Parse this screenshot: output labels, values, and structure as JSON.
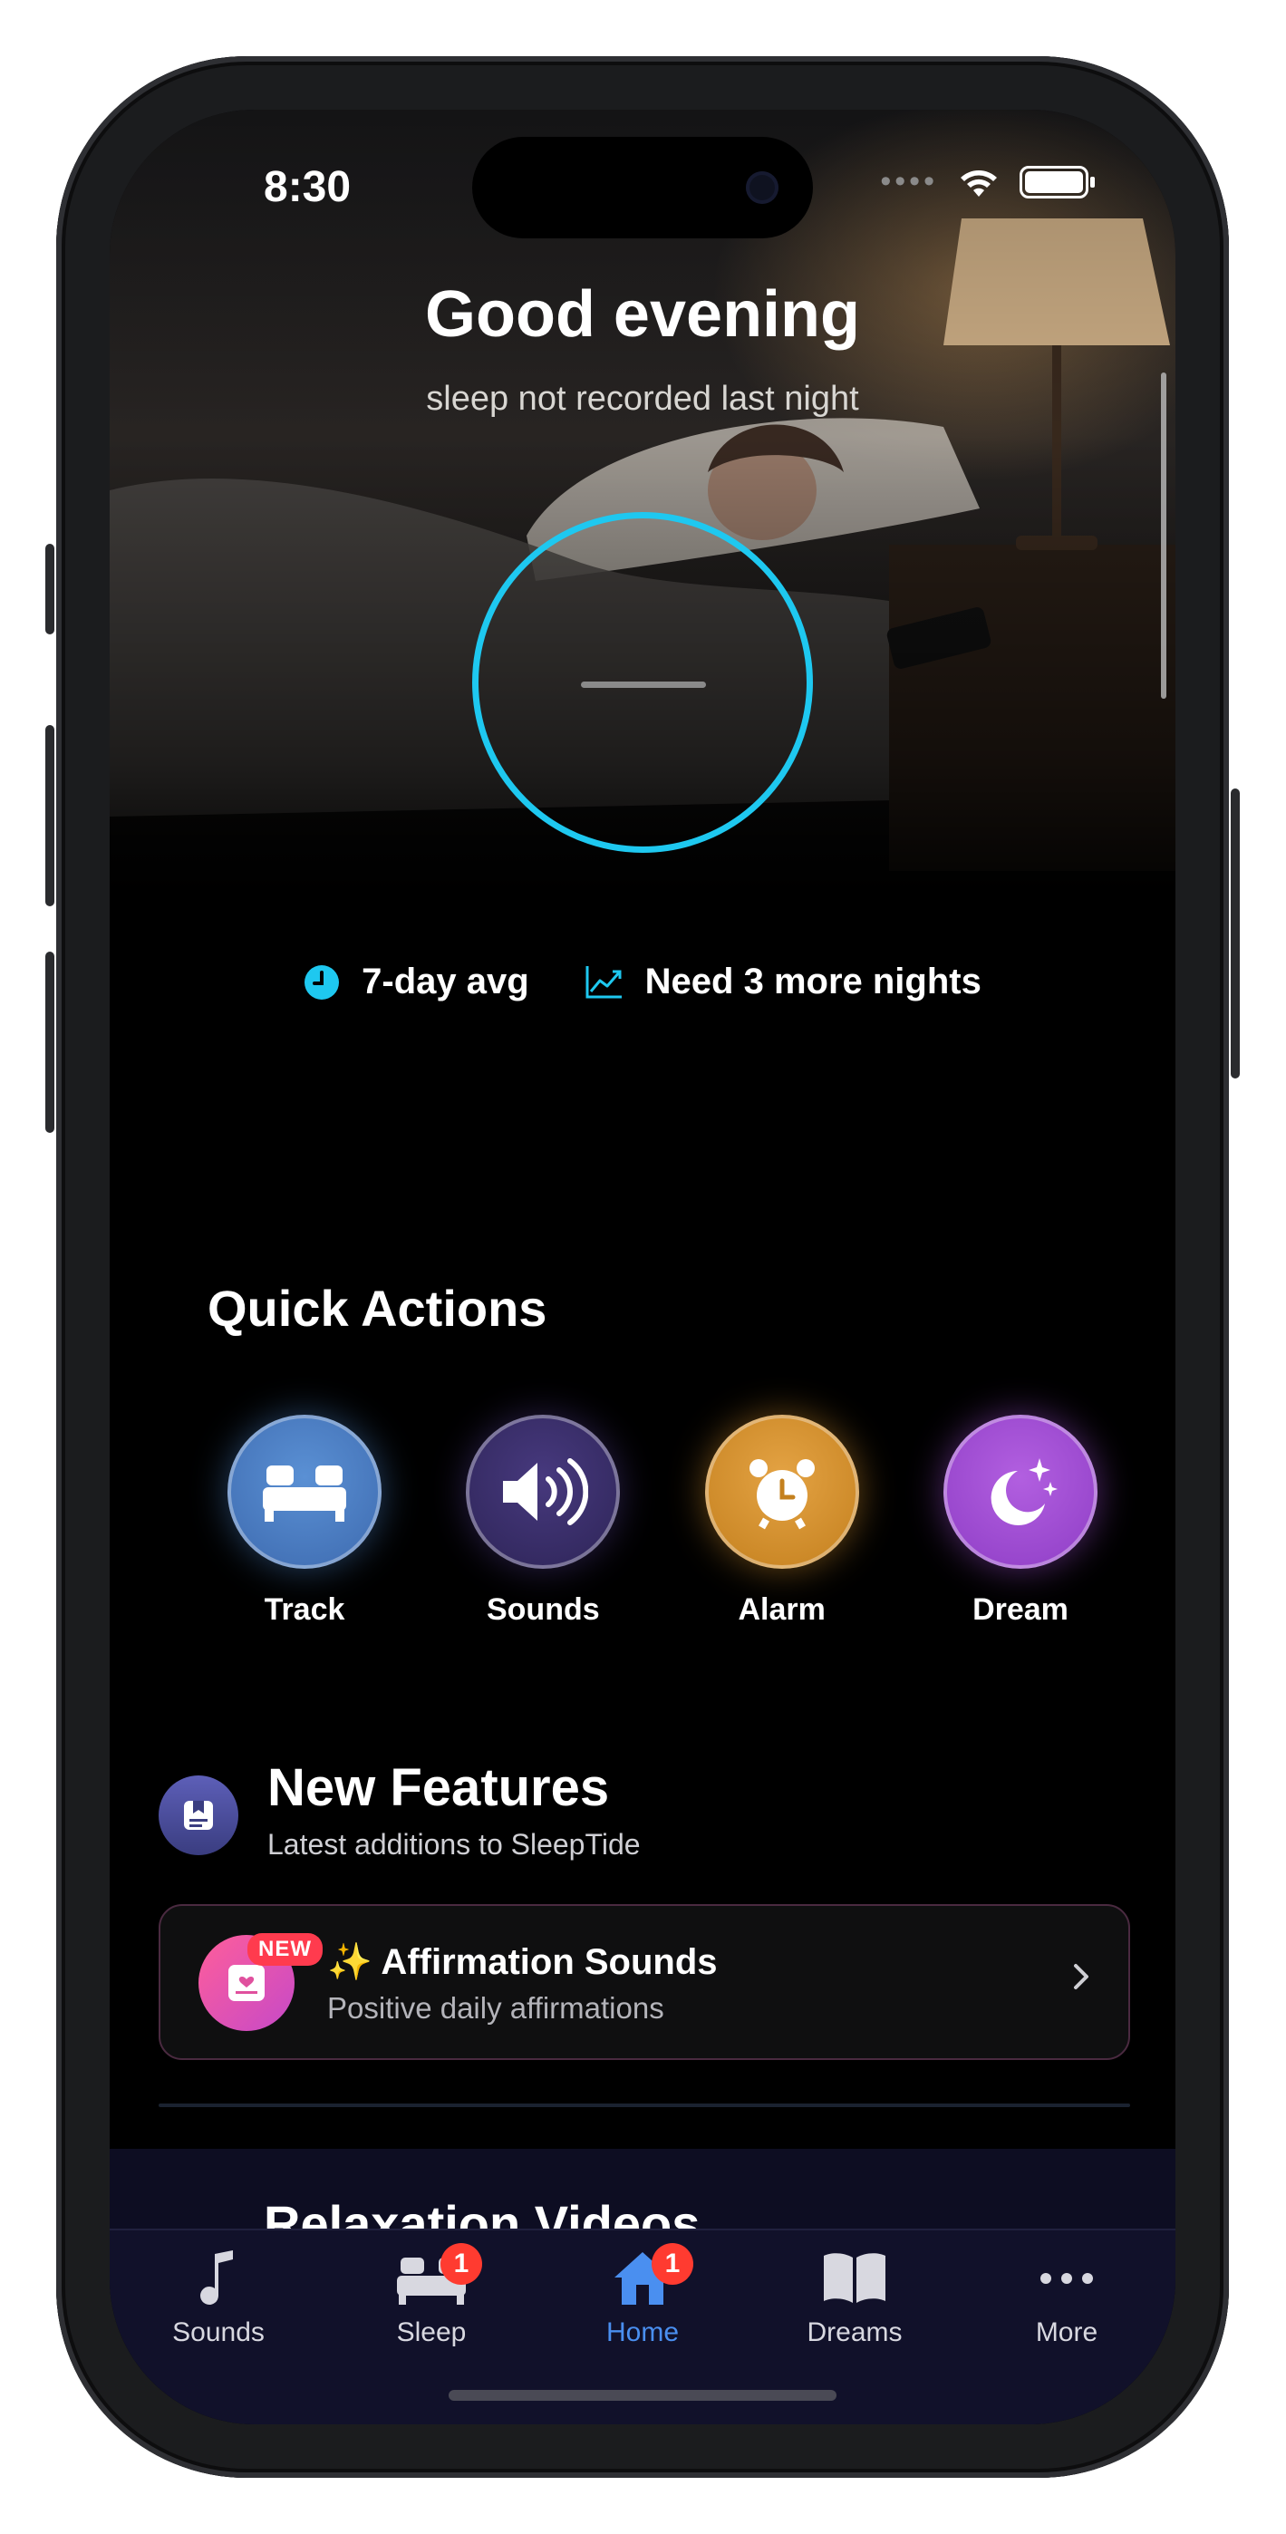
{
  "status_bar": {
    "time": "8:30"
  },
  "hero": {
    "greeting": "Good evening",
    "subtitle": "sleep not recorded last night"
  },
  "stats": {
    "avg_label": "7-day avg",
    "nights_label": "Need 3 more nights",
    "accent_color": "#1ec8f0"
  },
  "quick_actions": {
    "title": "Quick Actions",
    "items": [
      {
        "label": "Track",
        "icon": "bed-icon",
        "color": "#4a7fc4"
      },
      {
        "label": "Sounds",
        "icon": "speaker-icon",
        "color": "#3a2f6a"
      },
      {
        "label": "Alarm",
        "icon": "alarm-clock-icon",
        "color": "#d4902c"
      },
      {
        "label": "Dream",
        "icon": "moon-stars-icon",
        "color": "#a24fd6"
      }
    ]
  },
  "new_features": {
    "title": "New Features",
    "subtitle": "Latest additions to SleepTide",
    "card": {
      "badge": "NEW",
      "title": "✨ Affirmation Sounds",
      "subtitle": "Positive daily affirmations"
    }
  },
  "relaxation": {
    "title": "Relaxation Videos"
  },
  "tab_bar": {
    "active_color": "#4a8ff0",
    "tabs": [
      {
        "label": "Sounds",
        "icon": "music-note-icon"
      },
      {
        "label": "Sleep",
        "icon": "bed-icon",
        "badge": "1"
      },
      {
        "label": "Home",
        "icon": "house-icon",
        "badge": "1"
      },
      {
        "label": "Dreams",
        "icon": "book-icon"
      },
      {
        "label": "More",
        "icon": "ellipsis-icon"
      }
    ]
  }
}
